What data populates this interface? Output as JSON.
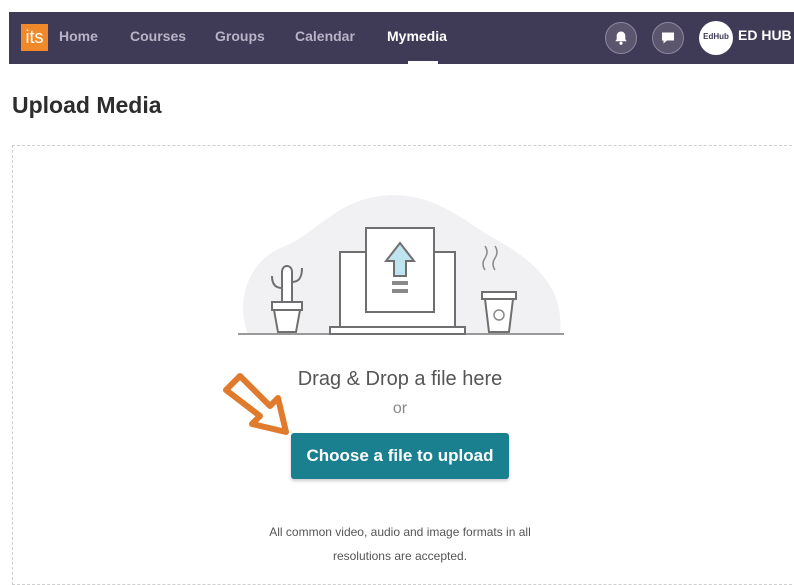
{
  "nav": {
    "logo_text": "its",
    "items": [
      {
        "label": "Home"
      },
      {
        "label": "Courses"
      },
      {
        "label": "Groups"
      },
      {
        "label": "Calendar"
      },
      {
        "label": "Mymedia"
      }
    ],
    "active_item": "Mymedia",
    "avatar_text": "EdHub",
    "user_name": "ED HUB",
    "icons": [
      "bell-icon",
      "chat-icon"
    ]
  },
  "page": {
    "title": "Upload Media"
  },
  "upload": {
    "drag_text": "Drag & Drop a file here",
    "or_text": "or",
    "button_label": "Choose a file to upload",
    "formats_line1": "All common video, audio and image formats in all",
    "formats_line2": "resolutions are accepted."
  },
  "colors": {
    "navbar": "#3f3a55",
    "logo": "#f0892a",
    "button": "#1a7f8f",
    "arrow": "#e07a2c"
  }
}
